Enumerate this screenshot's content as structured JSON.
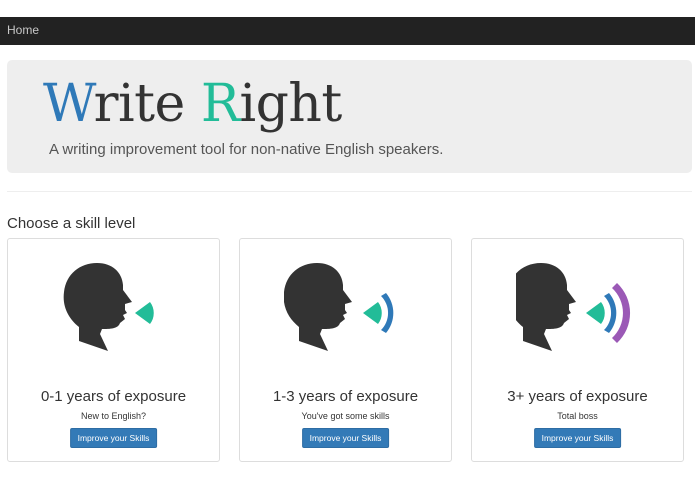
{
  "navbar": {
    "home_label": "Home"
  },
  "jumbotron": {
    "brand_first_initial": "W",
    "brand_first_rest": "rite ",
    "brand_second_initial": "R",
    "brand_second_rest": "ight",
    "tagline": "A writing improvement tool for non-native English speakers."
  },
  "section": {
    "title": "Choose a skill level"
  },
  "cards": [
    {
      "title": "0-1 years of exposure",
      "subtitle": "New to English?",
      "button_label": "Improve your Skills",
      "icon": "head-speaking-one-wave-icon"
    },
    {
      "title": "1-3 years of exposure",
      "subtitle": "You've got some skills",
      "button_label": "Improve your Skills",
      "icon": "head-speaking-two-waves-icon"
    },
    {
      "title": "3+ years of exposure",
      "subtitle": "Total boss",
      "button_label": "Improve your Skills",
      "icon": "head-speaking-three-waves-icon"
    }
  ],
  "colors": {
    "navbar_bg": "#222222",
    "brand_w": "#2f79b8",
    "brand_r": "#22bc98",
    "wave_teal": "#22bc98",
    "wave_blue": "#2f79b8",
    "wave_purple": "#9b59b6",
    "head": "#333333",
    "button": "#337ab7"
  }
}
